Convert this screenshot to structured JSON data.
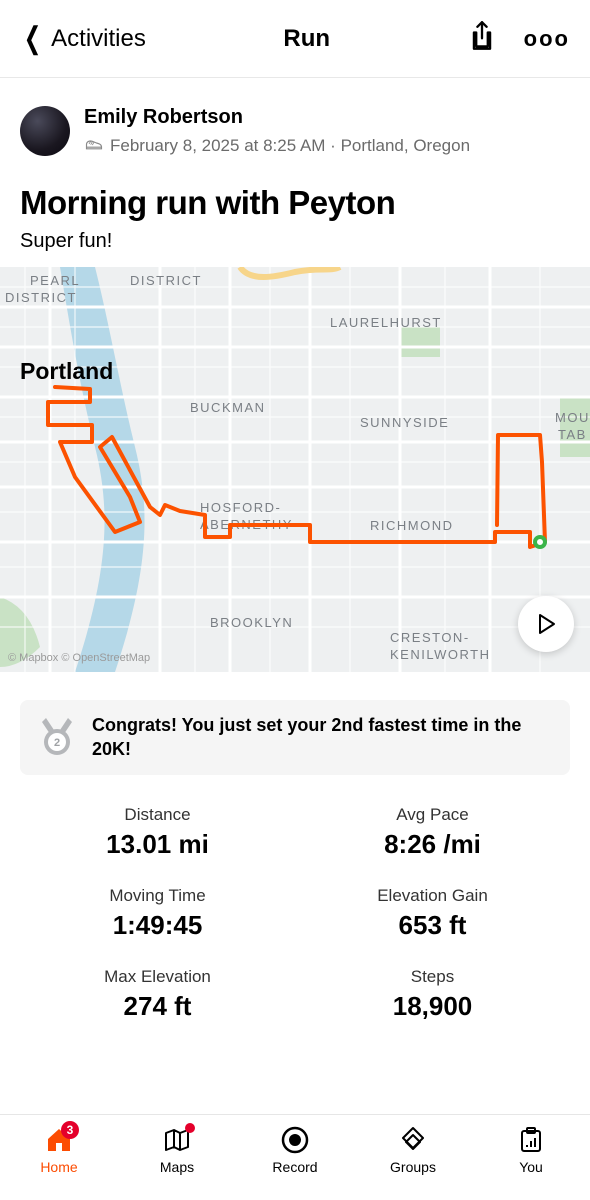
{
  "topbar": {
    "back": "Activities",
    "title": "Run"
  },
  "user": {
    "name": "Emily Robertson",
    "meta": "February 8, 2025 at 8:25 AM · Portland, Oregon"
  },
  "activity": {
    "title": "Morning run with Peyton",
    "description": "Super fun!"
  },
  "map": {
    "city_label": "Portland",
    "neighborhoods": [
      "PEARL",
      "DISTRICT",
      "DISTRICT",
      "LAURELHURST",
      "BUCKMAN",
      "SUNNYSIDE",
      "MOU",
      "TAB",
      "HOSFORD-",
      "ABERNETHY",
      "RICHMOND",
      "BROOKLYN",
      "CRESTON-",
      "KENILWORTH"
    ],
    "attribution": "© Mapbox © OpenStreetMap"
  },
  "congrats": "Congrats! You just set your 2nd fastest time in the 20K!",
  "medal_rank": "2",
  "stats": [
    {
      "label": "Distance",
      "value": "13.01 mi"
    },
    {
      "label": "Avg Pace",
      "value": "8:26 /mi"
    },
    {
      "label": "Moving Time",
      "value": "1:49:45"
    },
    {
      "label": "Elevation Gain",
      "value": "653 ft"
    },
    {
      "label": "Max Elevation",
      "value": "274 ft"
    },
    {
      "label": "Steps",
      "value": "18,900"
    }
  ],
  "tabs": [
    {
      "label": "Home",
      "badge": "3",
      "active": true
    },
    {
      "label": "Maps",
      "dot": true
    },
    {
      "label": "Record"
    },
    {
      "label": "Groups"
    },
    {
      "label": "You"
    }
  ],
  "colors": {
    "accent": "#fc4c02",
    "route": "#fc5200"
  }
}
